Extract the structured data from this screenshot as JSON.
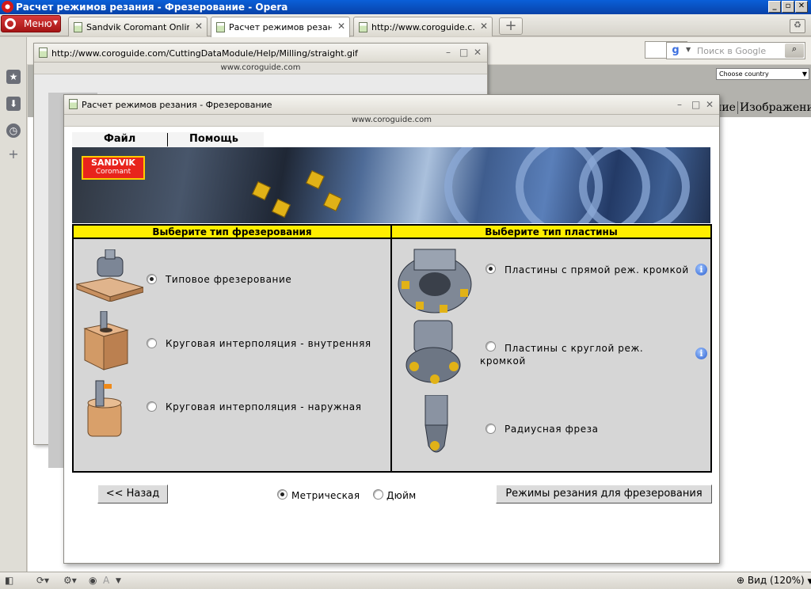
{
  "window": {
    "title": "Расчет режимов резания - Фрезерование - Opera",
    "minimize": "_",
    "maximize": "▫",
    "close": "✕"
  },
  "browser": {
    "menu_label": "Меню",
    "tabs": [
      {
        "label": "Sandvik Coromant Onlin…"
      },
      {
        "label": "Расчет режимов резан…"
      },
      {
        "label": "http://www.coroguide.c…"
      }
    ],
    "search_placeholder": "Поиск в Google",
    "background_page": {
      "country_select": "Choose country",
      "menu_items": [
        "ние",
        "Изображение"
      ]
    }
  },
  "popup_back": {
    "title": "http://www.coroguide.com/CuttingDataModule/Help/Milling/straight.gif",
    "url": "www.coroguide.com"
  },
  "popup_main": {
    "title": "Расчет режимов резания - Фрезерование",
    "url": "www.coroguide.com",
    "menu": {
      "file": "Файл",
      "help": "Помощь"
    },
    "logo": {
      "brand": "SANDVIK",
      "sub": "Coromant"
    },
    "milling_panel": {
      "header": "Выберите тип фрезерования",
      "options": [
        {
          "label": "Типовое фрезерование",
          "selected": true
        },
        {
          "label": "Круговая интерполяция - внутренняя",
          "selected": false
        },
        {
          "label": "Круговая интерполяция - наружная",
          "selected": false
        }
      ]
    },
    "insert_panel": {
      "header": "Выберите тип пластины",
      "options": [
        {
          "label": "Пластины с прямой реж. кромкой",
          "selected": true
        },
        {
          "label_line1": "Пластины с круглой реж.",
          "label_line2": "кромкой",
          "selected": false
        },
        {
          "label": "Радиусная фреза",
          "selected": false
        }
      ]
    },
    "back_button": "<< Назад",
    "units": {
      "metric": "Метрическая",
      "inch": "Дюйм",
      "selected": "metric"
    },
    "calc_button": "Режимы резания для фрезерования"
  },
  "statusbar": {
    "view_zoom": "Вид (120%)",
    "a_label": "A"
  }
}
